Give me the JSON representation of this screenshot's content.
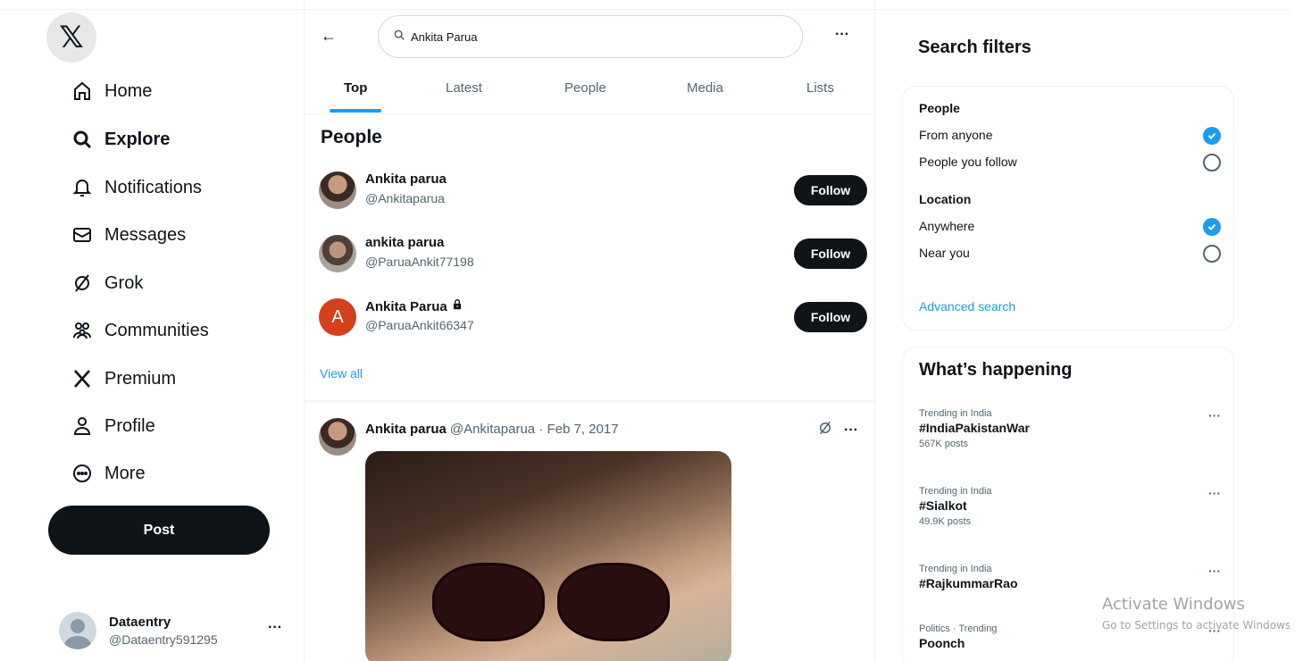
{
  "nav": {
    "logo": "𝕏",
    "items": [
      {
        "label": "Home",
        "icon": "home-icon"
      },
      {
        "label": "Explore",
        "icon": "search-icon"
      },
      {
        "label": "Notifications",
        "icon": "bell-icon"
      },
      {
        "label": "Messages",
        "icon": "envelope-icon"
      },
      {
        "label": "Grok",
        "icon": "grok-icon"
      },
      {
        "label": "Communities",
        "icon": "communities-icon"
      },
      {
        "label": "Premium",
        "icon": "x-logo-icon"
      },
      {
        "label": "Profile",
        "icon": "person-icon"
      },
      {
        "label": "More",
        "icon": "more-circle-icon"
      }
    ],
    "post_label": "Post",
    "account": {
      "name": "Dataentry",
      "handle": "@Dataentry591295",
      "more": "···"
    }
  },
  "search": {
    "back": "←",
    "value": "Ankita Parua",
    "more": "···"
  },
  "tabs": [
    "Top",
    "Latest",
    "People",
    "Media",
    "Lists"
  ],
  "people": {
    "title": "People",
    "items": [
      {
        "name": "Ankita parua",
        "handle": "@Ankitaparua",
        "follow": "Follow",
        "locked": false
      },
      {
        "name": "ankita parua",
        "handle": "@ParuaAnkit77198",
        "follow": "Follow",
        "locked": false
      },
      {
        "name": "Ankita Parua",
        "handle": "@ParuaAnkit66347",
        "follow": "Follow",
        "locked": true,
        "avatar_letter": "A"
      }
    ],
    "view_all": "View all"
  },
  "tweet": {
    "name": "Ankita parua",
    "meta": "@Ankitaparua · Feb 7, 2017",
    "more": "···"
  },
  "filters": {
    "title": "Search filters",
    "people_head": "People",
    "people_options": [
      {
        "label": "From anyone",
        "checked": true
      },
      {
        "label": "People you follow",
        "checked": false
      }
    ],
    "location_head": "Location",
    "location_options": [
      {
        "label": "Anywhere",
        "checked": true
      },
      {
        "label": "Near you",
        "checked": false
      }
    ],
    "advanced": "Advanced search"
  },
  "happening": {
    "title": "What’s happening",
    "trends": [
      {
        "context": "Trending in India",
        "tag": "#IndiaPakistanWar",
        "count": "567K posts"
      },
      {
        "context": "Trending in India",
        "tag": "#Sialkot",
        "count": "49.9K posts"
      },
      {
        "context": "Trending in India",
        "tag": "#RajkummarRao",
        "count": ""
      },
      {
        "context": "Politics · Trending",
        "tag": "Poonch",
        "count": ""
      }
    ],
    "more": "···"
  },
  "watermark": {
    "line1": "Activate Windows",
    "line2": "Go to Settings to activate Windows."
  },
  "colors": {
    "accent": "#1d9bf0",
    "text": "#0f1419",
    "muted": "#536471",
    "button": "#0f1419"
  }
}
